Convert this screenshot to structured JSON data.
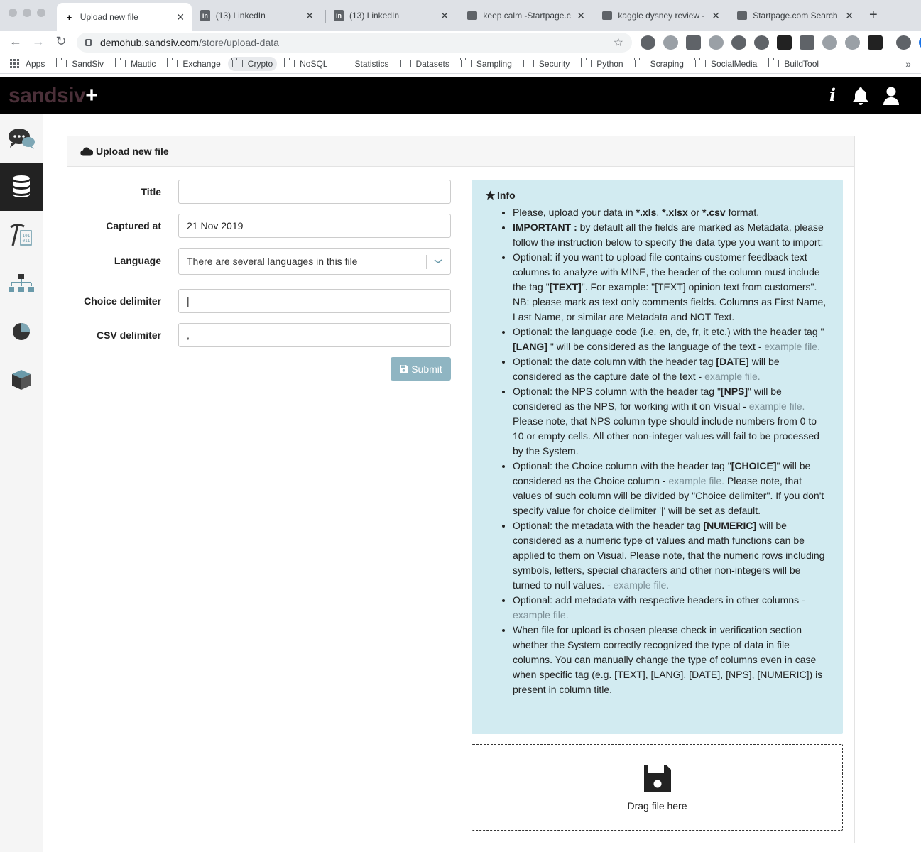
{
  "browser": {
    "tabs": [
      {
        "title": "Upload new file",
        "favicon": "S+",
        "active": true
      },
      {
        "title": "(13) LinkedIn",
        "favicon": "in",
        "active": false
      },
      {
        "title": "(13) LinkedIn",
        "favicon": "in",
        "active": false
      },
      {
        "title": "keep calm -Startpage.c",
        "favicon": "startpage-icon",
        "active": false
      },
      {
        "title": "kaggle dysney review -",
        "favicon": "startpage-icon",
        "active": false
      },
      {
        "title": "Startpage.com Search",
        "favicon": "startpage-icon",
        "active": false
      }
    ],
    "url_host": "demohub.sandsiv.com",
    "url_path": "/store/upload-data",
    "bookmarks": [
      {
        "label": "Apps",
        "type": "apps"
      },
      {
        "label": "SandSiv",
        "type": "folder"
      },
      {
        "label": "Mautic",
        "type": "folder"
      },
      {
        "label": "Exchange",
        "type": "folder"
      },
      {
        "label": "Crypto",
        "type": "folder",
        "active": true
      },
      {
        "label": "NoSQL",
        "type": "folder"
      },
      {
        "label": "Statistics",
        "type": "folder"
      },
      {
        "label": "Datasets",
        "type": "folder"
      },
      {
        "label": "Sampling",
        "type": "folder"
      },
      {
        "label": "Security",
        "type": "folder"
      },
      {
        "label": "Python",
        "type": "folder"
      },
      {
        "label": "Scraping",
        "type": "folder"
      },
      {
        "label": "SocialMedia",
        "type": "folder"
      },
      {
        "label": "BuildTool",
        "type": "folder"
      }
    ]
  },
  "app": {
    "logo_text": "sandsiv",
    "logo_plus": "+",
    "header_icons": [
      "info-icon",
      "bell-icon",
      "user-icon"
    ]
  },
  "sidebar": {
    "items": [
      {
        "icon": "chat-bubbles-icon",
        "active": false
      },
      {
        "icon": "database-icon",
        "active": true
      },
      {
        "icon": "mining-tool-icon",
        "active": false
      },
      {
        "icon": "hierarchy-icon",
        "active": false
      },
      {
        "icon": "pie-chart-icon",
        "active": false
      },
      {
        "icon": "cube-icon",
        "active": false
      }
    ]
  },
  "panel": {
    "title": "Upload new file"
  },
  "form": {
    "title_label": "Title",
    "title_value": "",
    "captured_label": "Captured at",
    "captured_value": "21 Nov 2019",
    "language_label": "Language",
    "language_value": "There are several languages in this file",
    "choice_label": "Choice delimiter",
    "choice_value": "|",
    "csv_label": "CSV delimiter",
    "csv_value": ",",
    "submit_label": "Submit"
  },
  "info": {
    "title": "Info",
    "example_link": "example file.",
    "items": {
      "i1": {
        "a": "Please, upload your data in ",
        "b1": "*.xls",
        "c": ", ",
        "b2": "*.xlsx",
        "d": " or ",
        "b3": "*.csv",
        "e": " format."
      },
      "i2": {
        "b": "IMPORTANT :",
        "t": " by default all the fields are marked as Metadata, please follow the instruction below to specify the data type you want to import:"
      },
      "i3": {
        "a": "Optional: if you want to upload file contains customer feedback text columns to analyze with MINE, the header of the column must include the tag \"",
        "b": "[TEXT]",
        "c": "\". For example: \"[TEXT] opinion text from customers\". NB: please mark as text only comments fields. Columns as First Name, Last Name, or similar are Metadata and NOT Text."
      },
      "i4": {
        "a": "Optional: the language code (i.e. en, de, fr, it etc.) with the header tag \"",
        "b": "[LANG]",
        "c": " \" will be considered as the language of the text - "
      },
      "i5": {
        "a": "Optional: the date column with the header tag ",
        "b": "[DATE]",
        "c": " will be considered as the capture date of the text - "
      },
      "i6": {
        "a": "Optional: the NPS column with the header tag \"",
        "b": "[NPS]",
        "c": "\" will be considered as the NPS, for working with it on Visual - ",
        "d": " Please note, that NPS column type should include numbers from 0 to 10 or empty cells. All other non-integer values will fail to be processed by the System."
      },
      "i7": {
        "a": "Optional: the Choice column with the header tag \"",
        "b": "[CHOICE]",
        "c": "\" will be considered as the Choice column - ",
        "d": " Please note, that values of such column will be divided by \"Choice delimiter\". If you don't specify value for choice delimiter '|' will be set as default."
      },
      "i8": {
        "a": "Optional: the metadata with the header tag ",
        "b": "[NUMERIC]",
        "c": " will be considered as a numeric type of values and math functions can be applied to them on Visual. Please note, that the numeric rows including symbols, letters, special characters and other non-integers will be turned to null values. - "
      },
      "i9": {
        "a": "Optional: add metadata with respective headers in other columns - "
      },
      "i10": {
        "a": "When file for upload is chosen please check in verification section whether the System correctly recognized the type of data in file columns. You can manually change the type of columns even in case when specific tag (e.g. [TEXT], [LANG], [DATE], [NPS], [NUMERIC]) is present in column title."
      }
    }
  },
  "dropzone": {
    "text": "Drag file here"
  }
}
